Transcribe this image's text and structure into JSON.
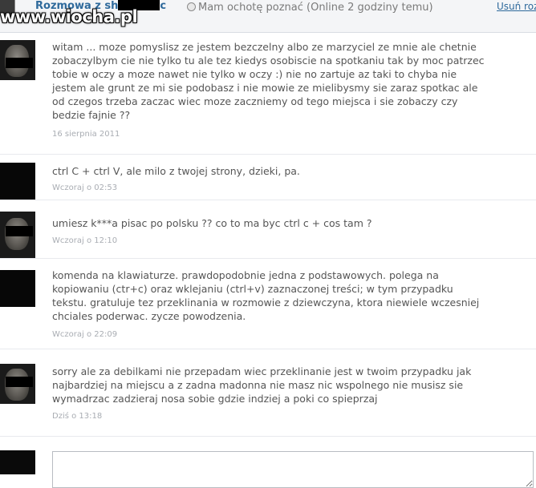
{
  "header": {
    "title_prefix": "Rozmowa z sh",
    "title_suffix": "c",
    "watermark": "www.wiocha.pl",
    "status_text": "Mam ochotę poznać (Online 2 godziny temu)",
    "delete_label": "Usuń roz"
  },
  "messages": [
    {
      "text": "witam ... moze pomyslisz ze jestem bezczelny albo ze marzyciel ze mnie ale chetnie zobaczylbym cie nie tylko tu ale tez kiedys osobiscie na spotkaniu tak by moc patrzec tobie w oczy a moze nawet nie tylko w oczy :) nie no zartuje az taki to chyba nie jestem ale grunt ze mi sie podobasz i nie mowie ze mielibysmy sie zaraz spotkac ale od czegos trzeba zaczac wiec moze zaczniemy od tego miejsca i sie zobaczy czy bedzie fajnie ??",
      "time": "16 sierpnia 2011"
    },
    {
      "text": "ctrl C + ctrl V, ale milo z twojej strony, dzieki, pa.",
      "time": "Wczoraj o 02:53"
    },
    {
      "text": "umiesz k***a pisac po polsku ?? co to ma byc ctrl c + cos tam ?",
      "time": "Wczoraj o 12:10"
    },
    {
      "text": "komenda na klawiaturze. prawdopodobnie jedna z podstawowych. polega na kopiowaniu (ctr+c) oraz wklejaniu (ctrl+v) zaznaczonej treści; w tym przypadku tekstu. gratuluje tez przeklinania w rozmowie z dziewczyna, ktora niewiele wczesniej chciales poderwac. zycze powodzenia.",
      "time": "Wczoraj o 22:09"
    },
    {
      "text": "sorry ale za debilkami nie przepadam wiec przeklinanie jest w twoim przypadku jak najbardziej na miejscu a z zadna madonna nie masz nic wspolnego nie musisz sie wymadrzac zadzieraj nosa sobie gdzie indziej a poki co spieprzaj",
      "time": "Dziś o 13:18"
    }
  ],
  "reply": {
    "value": ""
  }
}
